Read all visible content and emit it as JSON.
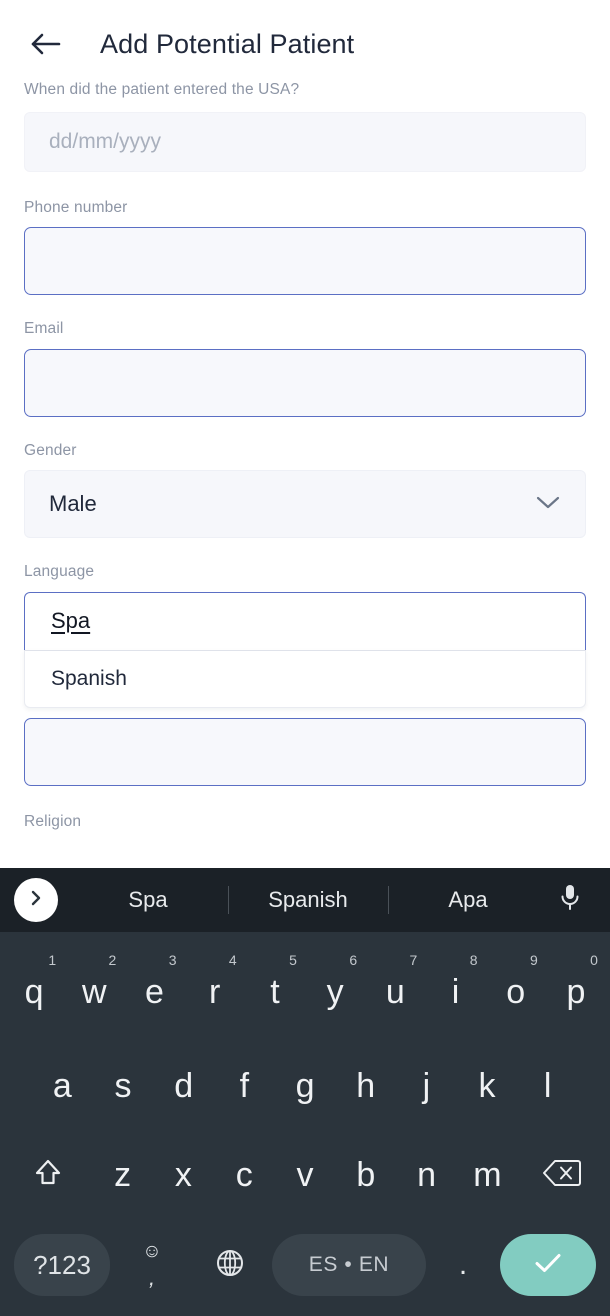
{
  "header": {
    "back_icon": "arrow-left-icon",
    "title": "Add Potential Patient"
  },
  "form": {
    "fields": [
      {
        "label": "When did the patient entered the USA?",
        "type": "date",
        "value": "",
        "placeholder": "dd/mm/yyyy"
      },
      {
        "label": "Phone number",
        "type": "text",
        "value": "",
        "placeholder": ""
      },
      {
        "label": "Email",
        "type": "email",
        "value": "",
        "placeholder": ""
      },
      {
        "label": "Gender",
        "type": "select",
        "value": "Male",
        "chevron_icon": "chevron-down-icon"
      },
      {
        "label": "Language",
        "type": "autocomplete",
        "value": "Spa",
        "options": [
          "Spanish"
        ]
      },
      {
        "label": "",
        "type": "text",
        "value": "",
        "placeholder": ""
      },
      {
        "label": "Religion",
        "type": "text",
        "value": "",
        "placeholder": ""
      }
    ]
  },
  "keyboard": {
    "suggestions": {
      "expand_icon": "chevron-right-icon",
      "items": [
        "Spa",
        "Spanish",
        "Apa"
      ],
      "mic_icon": "microphone-icon"
    },
    "row1": [
      {
        "char": "q",
        "num": "1"
      },
      {
        "char": "w",
        "num": "2"
      },
      {
        "char": "e",
        "num": "3"
      },
      {
        "char": "r",
        "num": "4"
      },
      {
        "char": "t",
        "num": "5"
      },
      {
        "char": "y",
        "num": "6"
      },
      {
        "char": "u",
        "num": "7"
      },
      {
        "char": "i",
        "num": "8"
      },
      {
        "char": "o",
        "num": "9"
      },
      {
        "char": "p",
        "num": "0"
      }
    ],
    "row2": [
      {
        "char": "a"
      },
      {
        "char": "s"
      },
      {
        "char": "d"
      },
      {
        "char": "f"
      },
      {
        "char": "g"
      },
      {
        "char": "h"
      },
      {
        "char": "j"
      },
      {
        "char": "k"
      },
      {
        "char": "l"
      }
    ],
    "row3": {
      "shift_icon": "shift-up-arrow-icon",
      "keys": [
        {
          "char": "z"
        },
        {
          "char": "x"
        },
        {
          "char": "c"
        },
        {
          "char": "v"
        },
        {
          "char": "b"
        },
        {
          "char": "n"
        },
        {
          "char": "m"
        }
      ],
      "backspace_icon": "backspace-delete-icon"
    },
    "row4": {
      "symbols_label": "?123",
      "emoji_icon": "smiley-face-icon",
      "comma_label": ",",
      "globe_icon": "globe-language-icon",
      "space_label": "ES • EN",
      "period_label": ".",
      "enter_icon": "checkmark-icon"
    }
  },
  "colors": {
    "accent_border": "#5b6fc4",
    "field_fill": "#f6f7fb",
    "keyboard_bg": "#2b343c",
    "suggestion_bg": "#1b2127",
    "enter_key": "#82ccc1",
    "title_text": "#21293b",
    "label_text": "#8d95a5"
  }
}
